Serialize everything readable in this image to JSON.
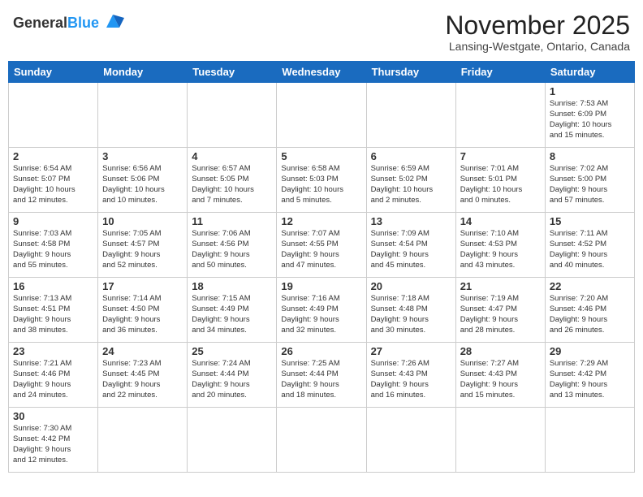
{
  "header": {
    "logo_general": "General",
    "logo_blue": "Blue",
    "month_title": "November 2025",
    "subtitle": "Lansing-Westgate, Ontario, Canada"
  },
  "weekdays": [
    "Sunday",
    "Monday",
    "Tuesday",
    "Wednesday",
    "Thursday",
    "Friday",
    "Saturday"
  ],
  "weeks": [
    [
      {
        "day": "",
        "info": ""
      },
      {
        "day": "",
        "info": ""
      },
      {
        "day": "",
        "info": ""
      },
      {
        "day": "",
        "info": ""
      },
      {
        "day": "",
        "info": ""
      },
      {
        "day": "",
        "info": ""
      },
      {
        "day": "1",
        "info": "Sunrise: 7:53 AM\nSunset: 6:09 PM\nDaylight: 10 hours\nand 15 minutes."
      }
    ],
    [
      {
        "day": "2",
        "info": "Sunrise: 6:54 AM\nSunset: 5:07 PM\nDaylight: 10 hours\nand 12 minutes."
      },
      {
        "day": "3",
        "info": "Sunrise: 6:56 AM\nSunset: 5:06 PM\nDaylight: 10 hours\nand 10 minutes."
      },
      {
        "day": "4",
        "info": "Sunrise: 6:57 AM\nSunset: 5:05 PM\nDaylight: 10 hours\nand 7 minutes."
      },
      {
        "day": "5",
        "info": "Sunrise: 6:58 AM\nSunset: 5:03 PM\nDaylight: 10 hours\nand 5 minutes."
      },
      {
        "day": "6",
        "info": "Sunrise: 6:59 AM\nSunset: 5:02 PM\nDaylight: 10 hours\nand 2 minutes."
      },
      {
        "day": "7",
        "info": "Sunrise: 7:01 AM\nSunset: 5:01 PM\nDaylight: 10 hours\nand 0 minutes."
      },
      {
        "day": "8",
        "info": "Sunrise: 7:02 AM\nSunset: 5:00 PM\nDaylight: 9 hours\nand 57 minutes."
      }
    ],
    [
      {
        "day": "9",
        "info": "Sunrise: 7:03 AM\nSunset: 4:58 PM\nDaylight: 9 hours\nand 55 minutes."
      },
      {
        "day": "10",
        "info": "Sunrise: 7:05 AM\nSunset: 4:57 PM\nDaylight: 9 hours\nand 52 minutes."
      },
      {
        "day": "11",
        "info": "Sunrise: 7:06 AM\nSunset: 4:56 PM\nDaylight: 9 hours\nand 50 minutes."
      },
      {
        "day": "12",
        "info": "Sunrise: 7:07 AM\nSunset: 4:55 PM\nDaylight: 9 hours\nand 47 minutes."
      },
      {
        "day": "13",
        "info": "Sunrise: 7:09 AM\nSunset: 4:54 PM\nDaylight: 9 hours\nand 45 minutes."
      },
      {
        "day": "14",
        "info": "Sunrise: 7:10 AM\nSunset: 4:53 PM\nDaylight: 9 hours\nand 43 minutes."
      },
      {
        "day": "15",
        "info": "Sunrise: 7:11 AM\nSunset: 4:52 PM\nDaylight: 9 hours\nand 40 minutes."
      }
    ],
    [
      {
        "day": "16",
        "info": "Sunrise: 7:13 AM\nSunset: 4:51 PM\nDaylight: 9 hours\nand 38 minutes."
      },
      {
        "day": "17",
        "info": "Sunrise: 7:14 AM\nSunset: 4:50 PM\nDaylight: 9 hours\nand 36 minutes."
      },
      {
        "day": "18",
        "info": "Sunrise: 7:15 AM\nSunset: 4:49 PM\nDaylight: 9 hours\nand 34 minutes."
      },
      {
        "day": "19",
        "info": "Sunrise: 7:16 AM\nSunset: 4:49 PM\nDaylight: 9 hours\nand 32 minutes."
      },
      {
        "day": "20",
        "info": "Sunrise: 7:18 AM\nSunset: 4:48 PM\nDaylight: 9 hours\nand 30 minutes."
      },
      {
        "day": "21",
        "info": "Sunrise: 7:19 AM\nSunset: 4:47 PM\nDaylight: 9 hours\nand 28 minutes."
      },
      {
        "day": "22",
        "info": "Sunrise: 7:20 AM\nSunset: 4:46 PM\nDaylight: 9 hours\nand 26 minutes."
      }
    ],
    [
      {
        "day": "23",
        "info": "Sunrise: 7:21 AM\nSunset: 4:46 PM\nDaylight: 9 hours\nand 24 minutes."
      },
      {
        "day": "24",
        "info": "Sunrise: 7:23 AM\nSunset: 4:45 PM\nDaylight: 9 hours\nand 22 minutes."
      },
      {
        "day": "25",
        "info": "Sunrise: 7:24 AM\nSunset: 4:44 PM\nDaylight: 9 hours\nand 20 minutes."
      },
      {
        "day": "26",
        "info": "Sunrise: 7:25 AM\nSunset: 4:44 PM\nDaylight: 9 hours\nand 18 minutes."
      },
      {
        "day": "27",
        "info": "Sunrise: 7:26 AM\nSunset: 4:43 PM\nDaylight: 9 hours\nand 16 minutes."
      },
      {
        "day": "28",
        "info": "Sunrise: 7:27 AM\nSunset: 4:43 PM\nDaylight: 9 hours\nand 15 minutes."
      },
      {
        "day": "29",
        "info": "Sunrise: 7:29 AM\nSunset: 4:42 PM\nDaylight: 9 hours\nand 13 minutes."
      }
    ],
    [
      {
        "day": "30",
        "info": "Sunrise: 7:30 AM\nSunset: 4:42 PM\nDaylight: 9 hours\nand 12 minutes."
      },
      {
        "day": "",
        "info": ""
      },
      {
        "day": "",
        "info": ""
      },
      {
        "day": "",
        "info": ""
      },
      {
        "day": "",
        "info": ""
      },
      {
        "day": "",
        "info": ""
      },
      {
        "day": "",
        "info": ""
      }
    ]
  ]
}
